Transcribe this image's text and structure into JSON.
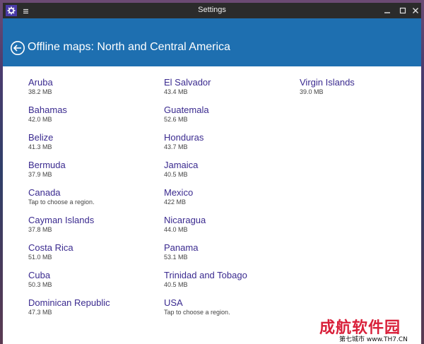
{
  "window": {
    "title": "Settings"
  },
  "header": {
    "title": "Offline maps: North and Central America"
  },
  "columns": [
    [
      {
        "name": "Aruba",
        "size": "38.2 MB"
      },
      {
        "name": "Bahamas",
        "size": "42.0 MB"
      },
      {
        "name": "Belize",
        "size": "41.3 MB"
      },
      {
        "name": "Bermuda",
        "size": "37.9 MB"
      },
      {
        "name": "Canada",
        "size": "Tap to choose a region."
      },
      {
        "name": "Cayman Islands",
        "size": "37.8 MB"
      },
      {
        "name": "Costa Rica",
        "size": "51.0 MB"
      },
      {
        "name": "Cuba",
        "size": "50.3 MB"
      },
      {
        "name": "Dominican Republic",
        "size": "47.3 MB"
      }
    ],
    [
      {
        "name": "El Salvador",
        "size": "43.4 MB"
      },
      {
        "name": "Guatemala",
        "size": "52.6 MB"
      },
      {
        "name": "Honduras",
        "size": "43.7 MB"
      },
      {
        "name": "Jamaica",
        "size": "40.5 MB"
      },
      {
        "name": "Mexico",
        "size": "422 MB"
      },
      {
        "name": "Nicaragua",
        "size": "44.0 MB"
      },
      {
        "name": "Panama",
        "size": "53.1 MB"
      },
      {
        "name": "Trinidad and Tobago",
        "size": "40.5 MB"
      },
      {
        "name": "USA",
        "size": "Tap to choose a region."
      }
    ],
    [
      {
        "name": "Virgin Islands",
        "size": "39.0 MB"
      }
    ]
  ],
  "watermark": {
    "main": "成航软件园",
    "sub": "第七城市 www.TH7.CN"
  },
  "icons": {
    "app": "gear-icon",
    "menu": "hamburger-icon",
    "back": "back-arrow-icon",
    "minimize": "minimize-icon",
    "maximize": "maximize-icon",
    "close": "close-icon"
  },
  "colors": {
    "header": "#1e6fb0",
    "titlebar": "#2b2b2b",
    "link": "#3a2a8f",
    "watermark": "#d9203a"
  }
}
